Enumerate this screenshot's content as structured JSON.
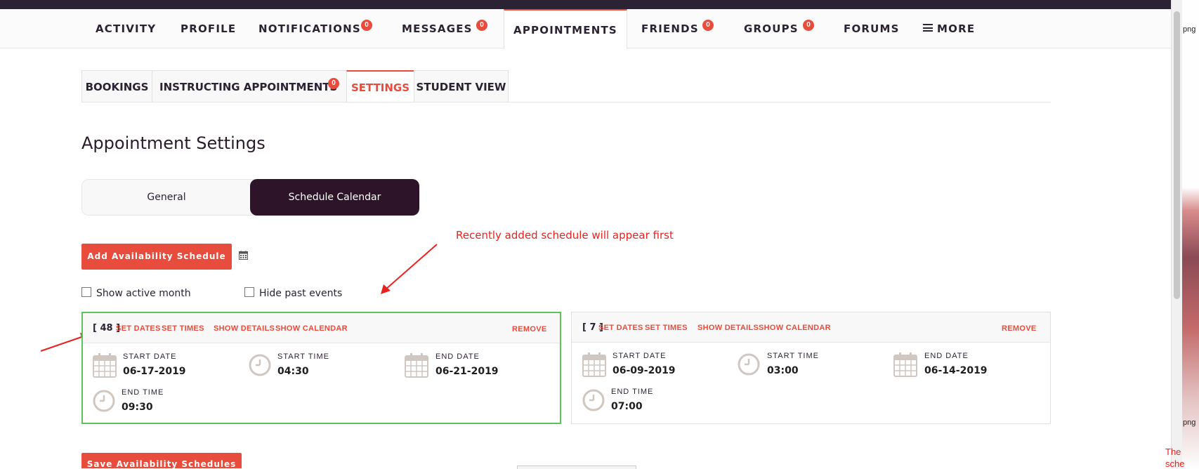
{
  "main_nav": {
    "items": [
      {
        "label": "ACTIVITY"
      },
      {
        "label": "PROFILE"
      },
      {
        "label": "NOTIFICATIONS",
        "badge": "0"
      },
      {
        "label": "MESSAGES",
        "badge": "0"
      },
      {
        "label": "APPOINTMENTS",
        "active": true
      },
      {
        "label": "FRIENDS",
        "badge": "0"
      },
      {
        "label": "GROUPS",
        "badge": "0"
      },
      {
        "label": "FORUMS"
      },
      {
        "label": "MORE",
        "icon": "hamburger-icon"
      }
    ]
  },
  "sub_nav": {
    "items": [
      {
        "label": "BOOKINGS"
      },
      {
        "label": "INSTRUCTING APPOINTMENTS",
        "badge": "0"
      },
      {
        "label": "SETTINGS",
        "active": true
      },
      {
        "label": "STUDENT VIEW"
      }
    ]
  },
  "page_title": "Appointment Settings",
  "toggle": {
    "general": "General",
    "schedule": "Schedule Calendar",
    "active": "Schedule Calendar"
  },
  "annotation_note": "Recently added schedule will appear first",
  "add_button": "Add Availability Schedule",
  "save_button": "Save Availability Schedules",
  "checkboxes": {
    "show_active_month": "Show active month",
    "hide_past_events": "Hide past events"
  },
  "schedules": [
    {
      "id": "[ 48 ]",
      "selected": true,
      "links": {
        "set_dates": "SET DATES",
        "set_times": "SET TIMES",
        "show_details": "SHOW DETAILS",
        "show_calendar": "SHOW CALENDAR",
        "remove": "REMOVE"
      },
      "start_date_label": "START DATE",
      "start_date": "06-17-2019",
      "start_time_label": "START TIME",
      "start_time": "04:30",
      "end_date_label": "END DATE",
      "end_date": "06-21-2019",
      "end_time_label": "END TIME",
      "end_time": "09:30"
    },
    {
      "id": "[ 7 ]",
      "selected": false,
      "links": {
        "set_dates": "SET DATES",
        "set_times": "SET TIMES",
        "show_details": "SHOW DETAILS",
        "show_calendar": "SHOW CALENDAR",
        "remove": "REMOVE"
      },
      "start_date_label": "START DATE",
      "start_date": "06-09-2019",
      "start_time_label": "START TIME",
      "start_time": "03:00",
      "end_date_label": "END DATE",
      "end_date": "06-14-2019",
      "end_time_label": "END TIME",
      "end_time": "07:00"
    }
  ],
  "right_strip": {
    "text_top": "png",
    "text_mid": "png",
    "text_red": "The",
    "text_red2": "sche"
  },
  "colors": {
    "accent": "#e74c3c",
    "dark": "#2d1428",
    "selected_border": "#5cc35c",
    "annotation": "#e8231f"
  }
}
